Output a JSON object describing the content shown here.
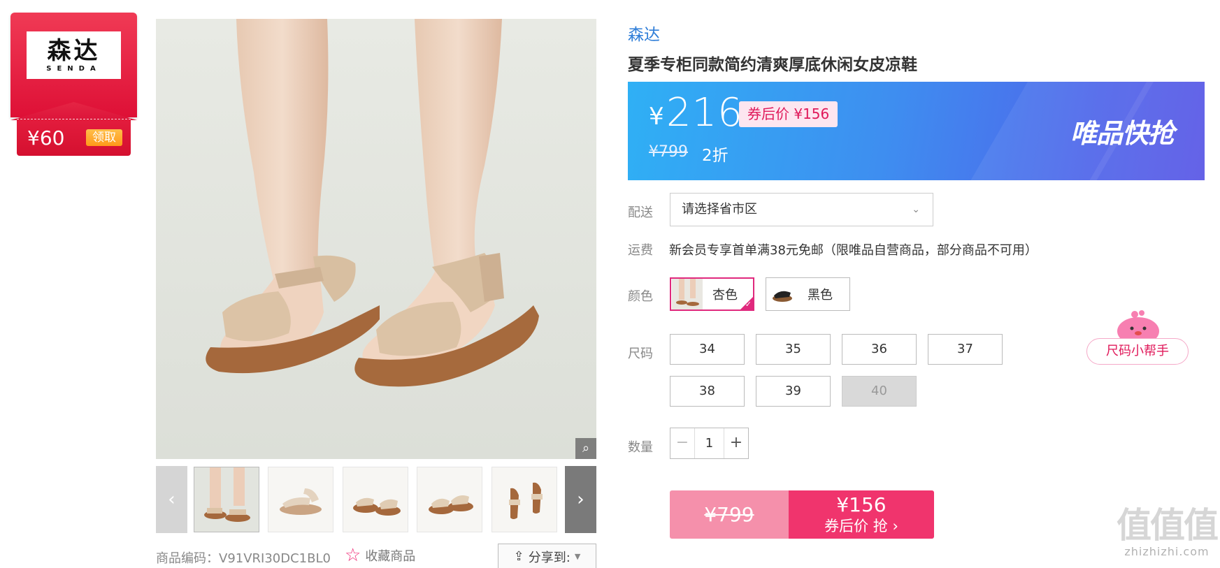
{
  "coupon": {
    "brand_cn": "森达",
    "brand_en": "SENDA",
    "amount": "¥60",
    "claim_label": "领取"
  },
  "gallery": {
    "prev_icon": "‹",
    "next_icon": "›",
    "zoom_icon": "search-icon"
  },
  "product_code": "商品编码：V91VRI30DC1BL0",
  "favorite_label": "收藏商品",
  "share_label": "分享到:",
  "brand": "森达",
  "title": "夏季专柜同款简约清爽厚底休闲女皮凉鞋",
  "price": {
    "currency": "¥",
    "current": "216",
    "after_coupon": "券后价 ¥156",
    "original": "¥799",
    "discount": "2折",
    "campaign": "唯品快抢"
  },
  "delivery": {
    "label": "配送",
    "placeholder": "请选择省市区"
  },
  "freight": {
    "label": "运费",
    "text": "新会员专享首单满38元免邮（限唯品自营商品，部分商品不可用）"
  },
  "color": {
    "label": "颜色",
    "options": [
      "杏色",
      "黑色"
    ],
    "selected": "杏色"
  },
  "size": {
    "label": "尺码",
    "options": [
      "34",
      "35",
      "36",
      "37",
      "38",
      "39",
      "40"
    ],
    "unavailable": [
      "40"
    ]
  },
  "size_helper_label": "尺码小帮手",
  "quantity": {
    "label": "数量",
    "minus": "−",
    "value": "1",
    "plus": "+"
  },
  "buy": {
    "original": "¥799",
    "price": "¥156",
    "action": "券后价 抢 ›"
  },
  "watermark": {
    "logo": "值值值",
    "url": "zhizhizhi.com"
  },
  "colors": {
    "accent_pink": "#f0346d",
    "brand_blue": "#2f7ed8",
    "coupon_red": "#e31c3d"
  }
}
